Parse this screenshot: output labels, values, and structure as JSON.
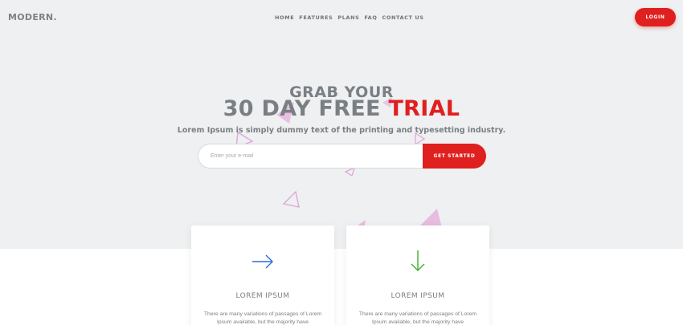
{
  "header": {
    "logo": "MODERN.",
    "nav": [
      "HOME",
      "FEATURES",
      "PLANS",
      "FAQ",
      "CONTACT US"
    ],
    "login_label": "LOGIN"
  },
  "hero": {
    "line1": "GRAB YOUR",
    "line2_main": "30 DAY FREE",
    "line2_accent": "TRIAL",
    "subtitle": "Lorem Ipsum is simply dummy text of the printing and typesetting industry.",
    "email_placeholder": "Enter your e-mail",
    "cta_label": "GET STARTED"
  },
  "features": [
    {
      "icon": "arrow-right-icon",
      "title": "LOREM IPSUM",
      "text": "There are many variations of passages of Lorem Ipsum available, but the majority have"
    },
    {
      "icon": "arrow-down-icon",
      "title": "LOREM IPSUM",
      "text": "There are many variations of passages of Lorem Ipsum available, but the majority have"
    }
  ],
  "colors": {
    "accent": "#e01f1f",
    "text": "#7a7f84",
    "background": "#eef0f1",
    "icon_blue": "#2c6fd6",
    "icon_green": "#3fae2a",
    "decor_pink": "#e0a6d9"
  }
}
